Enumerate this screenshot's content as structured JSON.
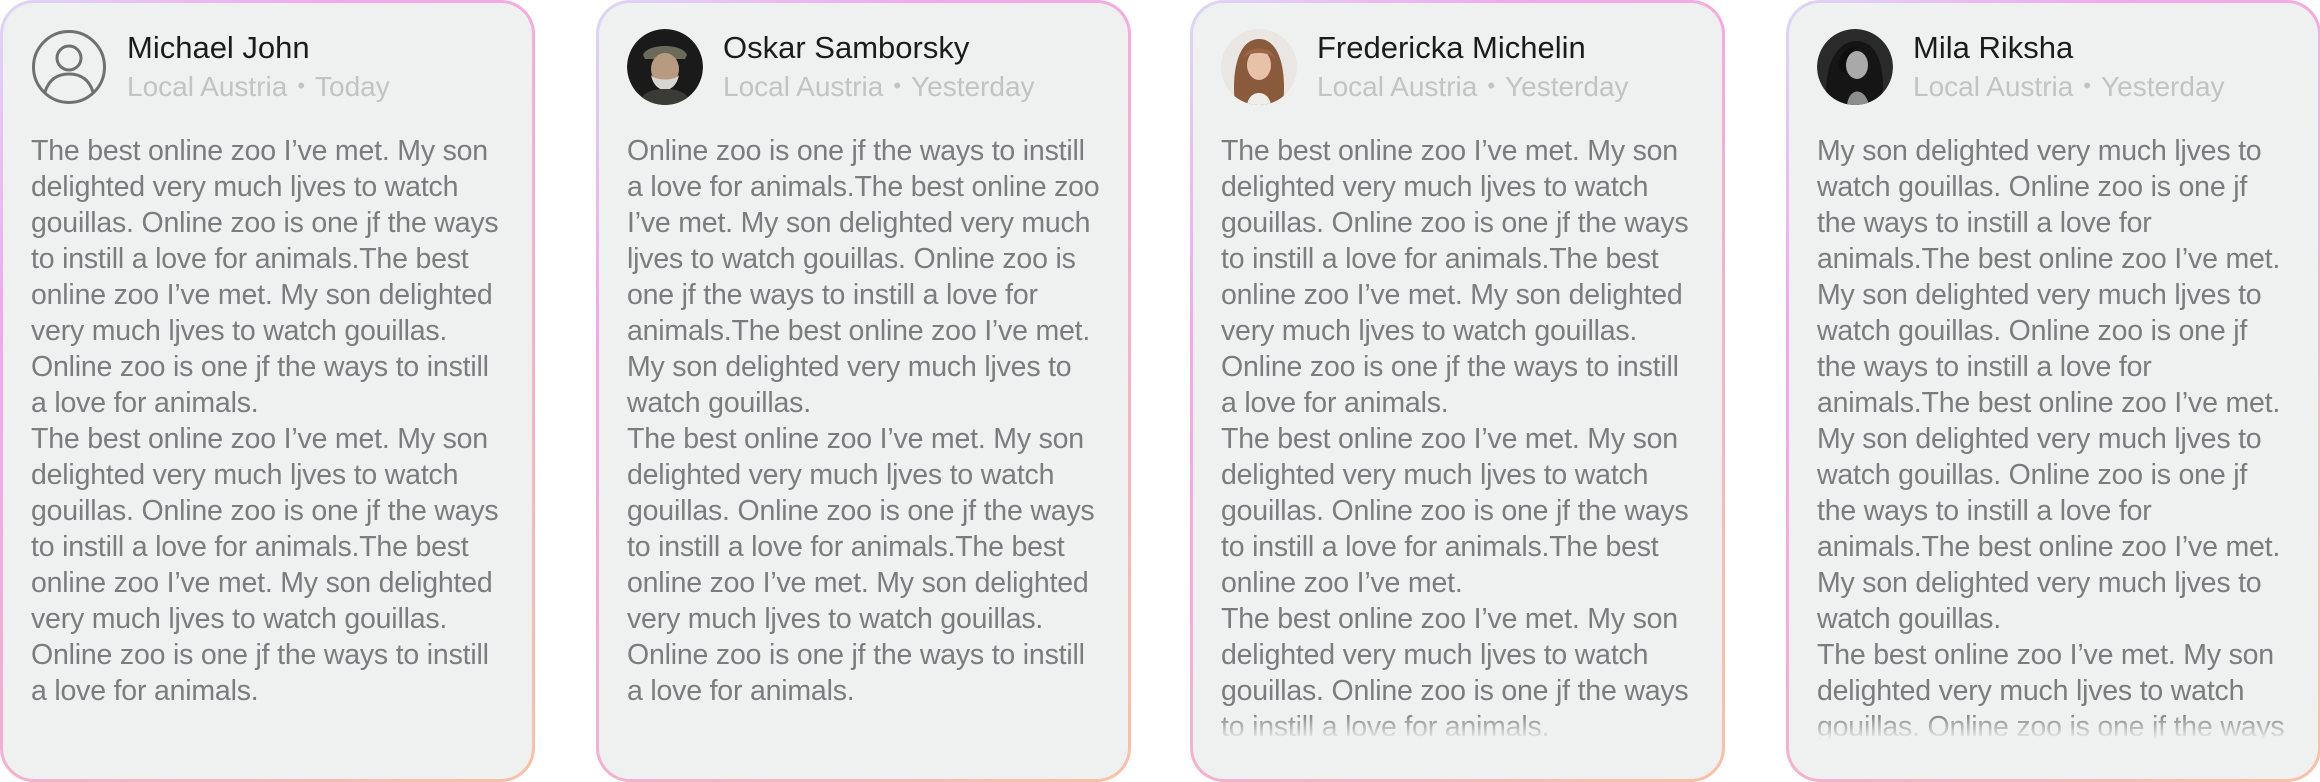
{
  "reviews": [
    {
      "name": "Michael John",
      "location": "Local Austria",
      "separator": "•",
      "date": "Today",
      "avatar": "user-outline-icon",
      "paragraphs": [
        "The best online zoo I’ve met. My son delighted very much ljves to watch gouillas. Online zoo is one jf the ways to instill a love for animals.The best online zoo I’ve met. My son delighted very much ljves to watch gouillas. Online zoo is one jf the ways to instill a love for animals.",
        "The best online zoo I’ve met. My son delighted very much ljves to watch gouillas. Online zoo is one jf the ways to instill a love for animals.The best online zoo I’ve met. My son delighted very much ljves to watch gouillas. Online zoo is one jf the ways to instill a love for animals."
      ]
    },
    {
      "name": "Oskar Samborsky",
      "location": "Local Austria",
      "separator": "•",
      "date": "Yesterday",
      "avatar": "old-man-photo",
      "paragraphs": [
        "Online zoo is one jf the ways to instill a love for animals.The best online zoo I’ve met. My son delighted very much ljves to watch gouillas. Online zoo is one jf the ways to instill a love for animals.The best online zoo I’ve met. My son delighted very much ljves to watch gouillas.",
        "The best online zoo I’ve met. My son delighted very much ljves to watch gouillas. Online zoo is one jf the ways to instill a love for animals.The best online zoo I’ve met. My son delighted very much ljves to watch gouillas. Online zoo is one jf the ways to instill a love for animals."
      ]
    },
    {
      "name": "Fredericka Michelin",
      "location": "Local Austria",
      "separator": "•",
      "date": "Yesterday",
      "avatar": "woman-photo",
      "paragraphs": [
        "The best online zoo I’ve met. My son delighted very much ljves to watch gouillas. Online zoo is one jf the ways to instill a love for animals.The best online zoo I’ve met. My son delighted very much ljves to watch gouillas. Online zoo is one jf the ways to instill a love for animals.",
        "The best online zoo I’ve met. My son delighted very much ljves to watch gouillas. Online zoo is one jf the ways to instill a love for animals.The best online zoo I’ve met.",
        "The best online zoo I’ve met. My son delighted very much ljves to watch gouillas. Online zoo is one jf the ways to instill a love for animals."
      ]
    },
    {
      "name": "Mila Riksha",
      "location": "Local Austria",
      "separator": "•",
      "date": "Yesterday",
      "avatar": "woman-bw-photo",
      "paragraphs": [
        "My son delighted very much ljves to watch gouillas. Online zoo is one jf the ways to instill a love for animals.The best online zoo I’ve met. My son delighted very much ljves to watch gouillas. Online zoo is one jf the ways to instill a love for animals.The best online zoo I’ve met. My son delighted very much ljves to watch gouillas. Online zoo is one jf the ways to instill a love for animals.The best online zoo I’ve met. My son delighted very much ljves to watch gouillas.",
        "The best online zoo I’ve met. My son delighted very much ljves to watch gouillas. Online zoo is one jf the ways to instill a love for animals."
      ]
    }
  ]
}
